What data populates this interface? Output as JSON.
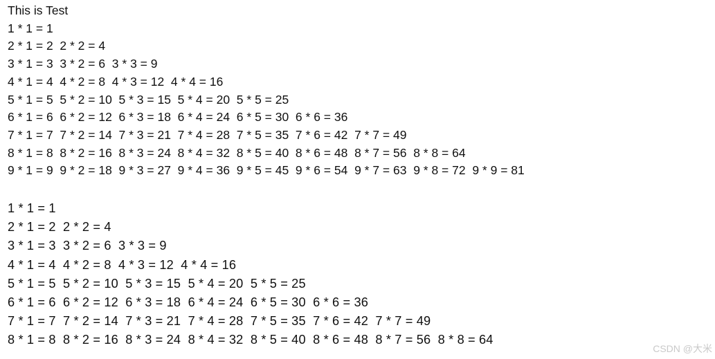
{
  "window": {
    "background_color": "#ffffff",
    "text_color": "#101010"
  },
  "block_one": {
    "title": "This is Test",
    "lines": [
      "1 * 1 = 1",
      "2 * 1 = 2  2 * 2 = 4",
      "3 * 1 = 3  3 * 2 = 6  3 * 3 = 9",
      "4 * 1 = 4  4 * 2 = 8  4 * 3 = 12  4 * 4 = 16",
      "5 * 1 = 5  5 * 2 = 10  5 * 3 = 15  5 * 4 = 20  5 * 5 = 25",
      "6 * 1 = 6  6 * 2 = 12  6 * 3 = 18  6 * 4 = 24  6 * 5 = 30  6 * 6 = 36",
      "7 * 1 = 7  7 * 2 = 14  7 * 3 = 21  7 * 4 = 28  7 * 5 = 35  7 * 6 = 42  7 * 7 = 49",
      "8 * 1 = 8  8 * 2 = 16  8 * 3 = 24  8 * 4 = 32  8 * 5 = 40  8 * 6 = 48  8 * 7 = 56  8 * 8 = 64",
      "9 * 1 = 9  9 * 2 = 18  9 * 3 = 27  9 * 4 = 36  9 * 5 = 45  9 * 6 = 54  9 * 7 = 63  9 * 8 = 72  9 * 9 = 81"
    ]
  },
  "block_two": {
    "lines": [
      "1 * 1 = 1",
      "2 * 1 = 2  2 * 2 = 4",
      "3 * 1 = 3  3 * 2 = 6  3 * 3 = 9",
      "4 * 1 = 4  4 * 2 = 8  4 * 3 = 12  4 * 4 = 16",
      "5 * 1 = 5  5 * 2 = 10  5 * 3 = 15  5 * 4 = 20  5 * 5 = 25",
      "6 * 1 = 6  6 * 2 = 12  6 * 3 = 18  6 * 4 = 24  6 * 5 = 30  6 * 6 = 36",
      "7 * 1 = 7  7 * 2 = 14  7 * 3 = 21  7 * 4 = 28  7 * 5 = 35  7 * 6 = 42  7 * 7 = 49",
      "8 * 1 = 8  8 * 2 = 16  8 * 3 = 24  8 * 4 = 32  8 * 5 = 40  8 * 6 = 48  8 * 7 = 56  8 * 8 = 64"
    ]
  },
  "watermark": {
    "text": "CSDN @大米",
    "color": "#c9c9c9"
  }
}
